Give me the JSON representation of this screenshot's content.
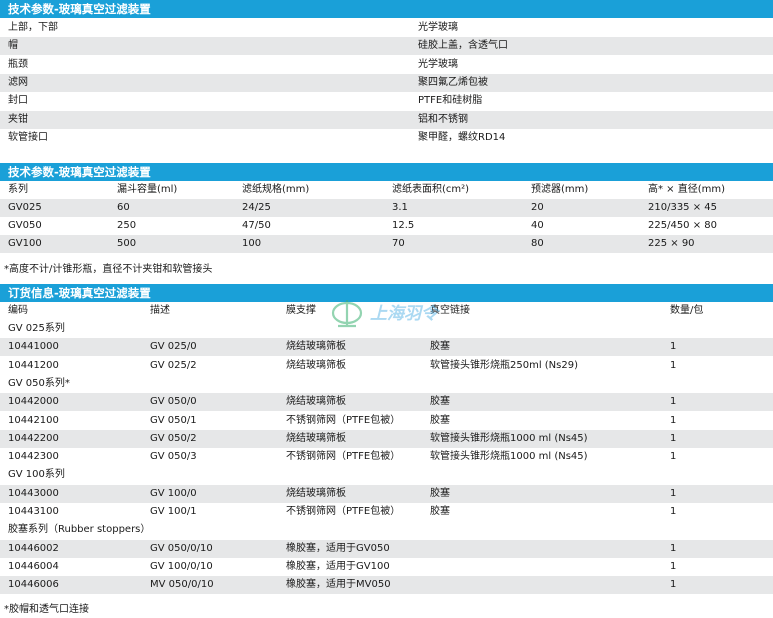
{
  "section1": {
    "title": "技术参数-玻璃真空过滤装置",
    "rows": [
      {
        "label": "上部，下部",
        "value": "光学玻璃"
      },
      {
        "label": "帽",
        "value": "硅胶上盖，含透气口"
      },
      {
        "label": "瓶颈",
        "value": "光学玻璃"
      },
      {
        "label": "滤网",
        "value": "聚四氟乙烯包被"
      },
      {
        "label": "封口",
        "value": "PTFE和硅树脂"
      },
      {
        "label": "夹钳",
        "value": "铝和不锈钢"
      },
      {
        "label": "软管接口",
        "value": "聚甲醛，螺纹RD14"
      }
    ]
  },
  "section2": {
    "title": "技术参数-玻璃真空过滤装置",
    "headers": [
      "系列",
      "漏斗容量(ml)",
      "滤纸规格(mm)",
      "滤纸表面积(cm²)",
      "预滤器(mm)",
      "高* × 直径(mm)"
    ],
    "rows": [
      [
        "GV025",
        "60",
        "24/25",
        "3.1",
        "20",
        "210/335 × 45"
      ],
      [
        "GV050",
        "250",
        "47/50",
        "12.5",
        "40",
        "225/450 × 80"
      ],
      [
        "GV100",
        "500",
        "100",
        "70",
        "80",
        "225 × 90"
      ]
    ],
    "note": "*高度不计/计锥形瓶，直径不计夹钳和软管接头"
  },
  "section3": {
    "title": "订货信息-玻璃真空过滤装置",
    "watermark": "上海羽令",
    "headers": [
      "编码",
      "描述",
      "膜支撑",
      "真空链接",
      "数量/包"
    ],
    "groups": [
      {
        "name": "GV 025系列",
        "rows": [
          [
            "10441000",
            "GV 025/0",
            "烧结玻璃筛板",
            "胶塞",
            "1"
          ],
          [
            "10441200",
            "GV 025/2",
            "烧结玻璃筛板",
            "软管接头锥形烧瓶250ml (Ns29)",
            "1"
          ]
        ]
      },
      {
        "name": "GV 050系列*",
        "rows": [
          [
            "10442000",
            "GV 050/0",
            "烧结玻璃筛板",
            "胶塞",
            "1"
          ],
          [
            "10442100",
            "GV 050/1",
            "不锈钢筛网（PTFE包被）",
            "胶塞",
            "1"
          ],
          [
            "10442200",
            "GV 050/2",
            "烧结玻璃筛板",
            "软管接头锥形烧瓶1000 ml (Ns45)",
            "1"
          ],
          [
            "10442300",
            "GV 050/3",
            "不锈钢筛网（PTFE包被）",
            "软管接头锥形烧瓶1000 ml (Ns45)",
            "1"
          ]
        ]
      },
      {
        "name": "GV 100系列",
        "rows": [
          [
            "10443000",
            "GV 100/0",
            "烧结玻璃筛板",
            "胶塞",
            "1"
          ],
          [
            "10443100",
            "GV 100/1",
            "不锈钢筛网（PTFE包被）",
            "胶塞",
            "1"
          ]
        ]
      },
      {
        "name": "胶塞系列（Rubber stoppers）",
        "rows": [
          [
            "10446002",
            "GV 050/0/10",
            "橡胶塞，适用于GV050",
            "",
            "1"
          ],
          [
            "10446004",
            "GV 100/0/10",
            "橡胶塞，适用于GV100",
            "",
            "1"
          ],
          [
            "10446006",
            "MV 050/0/10",
            "橡胶塞，适用于MV050",
            "",
            "1"
          ]
        ]
      }
    ],
    "note": "*胶帽和透气口连接"
  },
  "colors": {
    "header_blue": "#1aa0d8",
    "row_shade": "#e6e7e8",
    "watermark_green": "#3bb273",
    "watermark_blue": "#5ab4e6"
  }
}
